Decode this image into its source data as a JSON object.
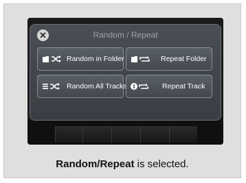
{
  "dialog": {
    "title": "Random / Repeat",
    "options": [
      {
        "label": "Random in Folder",
        "icon": "folder-shuffle-icon"
      },
      {
        "label": "Repeat Folder",
        "icon": "folder-repeat-icon"
      },
      {
        "label": "Random All Tracks",
        "icon": "list-shuffle-icon"
      },
      {
        "label": "Repeat Track",
        "icon": "one-repeat-icon"
      }
    ]
  },
  "caption": {
    "bold": "Random/Repeat",
    "rest": " is selected."
  }
}
